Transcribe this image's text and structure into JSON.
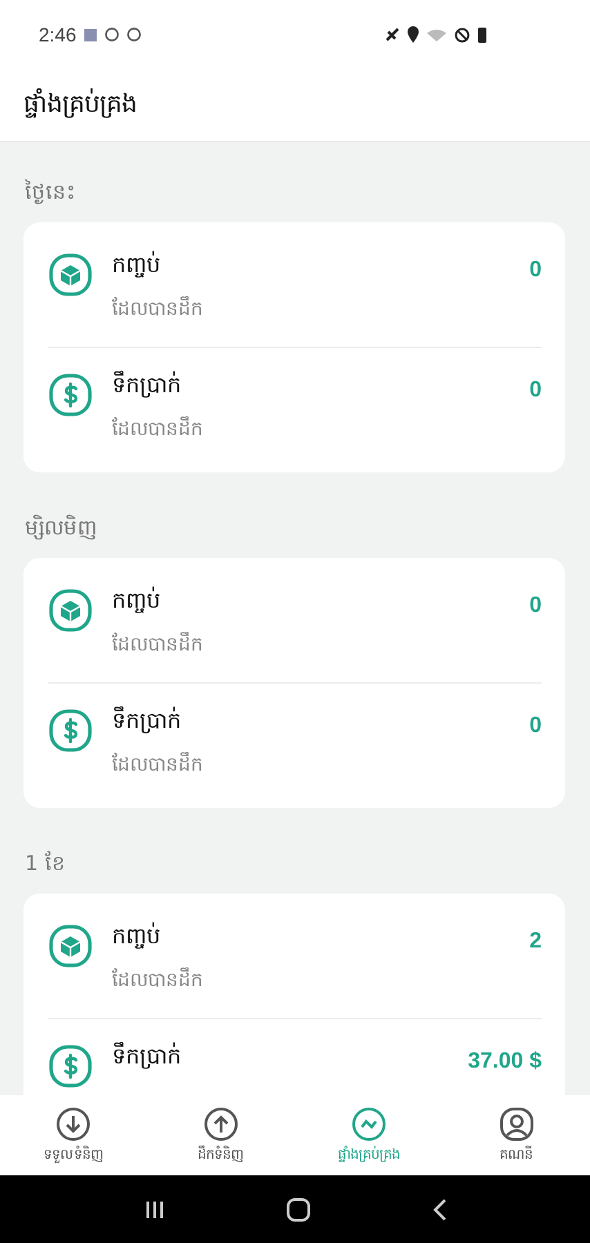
{
  "status_bar": {
    "time": "2:46"
  },
  "header": {
    "title": "ផ្ទាំងគ្រប់គ្រង"
  },
  "sections": [
    {
      "title": "ថ្ងៃនេះ",
      "rows": [
        {
          "kind": "package",
          "label": "កញ្ចប់",
          "subtitle": "ដែលបានដឹក",
          "value": "0"
        },
        {
          "kind": "money",
          "label": "ទឹកប្រាក់",
          "subtitle": "ដែលបានដឹក",
          "value": "0"
        }
      ]
    },
    {
      "title": "ម្សិលមិញ",
      "rows": [
        {
          "kind": "package",
          "label": "កញ្ចប់",
          "subtitle": "ដែលបានដឹក",
          "value": "0"
        },
        {
          "kind": "money",
          "label": "ទឹកប្រាក់",
          "subtitle": "ដែលបានដឹក",
          "value": "0"
        }
      ]
    },
    {
      "title": "1 ខែ",
      "rows": [
        {
          "kind": "package",
          "label": "កញ្ចប់",
          "subtitle": "ដែលបានដឹក",
          "value": "2"
        },
        {
          "kind": "money",
          "label": "ទឹកប្រាក់",
          "value": "37.00 $"
        }
      ]
    }
  ],
  "bottom_nav": [
    {
      "kind": "receive",
      "label": "ទទួលទំនិញ",
      "selected": false
    },
    {
      "kind": "deliver",
      "label": "ដឹកទំនិញ",
      "selected": false
    },
    {
      "kind": "dashboard",
      "label": "ផ្ទាំងគ្រប់គ្រង",
      "selected": true
    },
    {
      "kind": "account",
      "label": "គណនី",
      "selected": false
    }
  ]
}
